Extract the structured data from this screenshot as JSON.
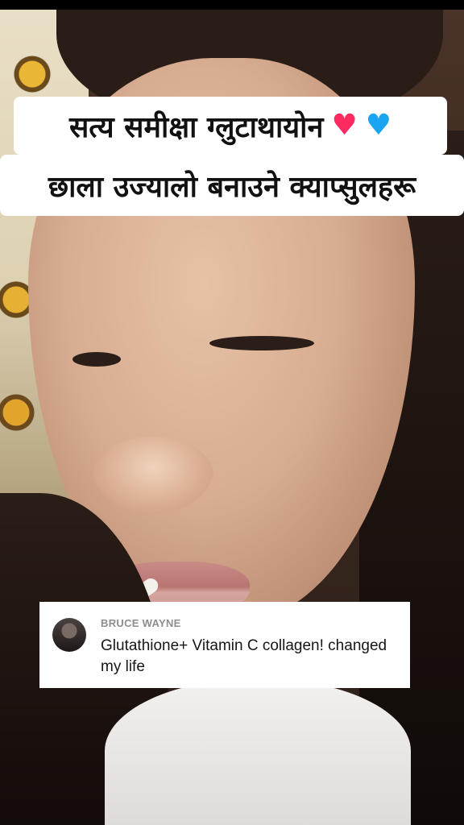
{
  "caption": {
    "line1": "सत्य समीक्षा ग्लुटाथायोन",
    "line2": "छाला उज्यालो बनाउने क्याप्सुलहरू",
    "emoji": [
      "♥",
      "♥"
    ]
  },
  "comment": {
    "username": "BRUCE WAYNE",
    "text": "Glutathione+ Vitamin C collagen! changed my life"
  },
  "colors": {
    "heart_pink": "#ff2a61",
    "heart_blue": "#1aa5f2"
  }
}
